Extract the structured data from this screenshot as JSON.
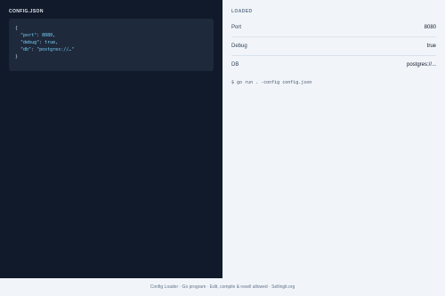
{
  "left_panel": {
    "title": "CONFIG.JSON",
    "code": {
      "open_brace": "{",
      "lines": [
        {
          "key": "\"port\"",
          "sep": ": ",
          "value": "8080",
          "trail": ","
        },
        {
          "key": "\"debug\"",
          "sep": ": ",
          "value": "true",
          "trail": ","
        },
        {
          "key": "\"db\"",
          "sep": ": ",
          "value": "\"postgres://…\"",
          "trail": ""
        }
      ],
      "close_brace": "}"
    }
  },
  "right_panel": {
    "title": "LOADED",
    "rows": [
      {
        "label": "Port",
        "value": "8080"
      },
      {
        "label": "Debug",
        "value": "true"
      },
      {
        "label": "DB",
        "value": "postgres://..."
      }
    ],
    "command": "$ go run . -config config.json"
  },
  "footer": {
    "text": "Config Loader · Go program · Edit, compile & resell allowed · Sellingit.org"
  },
  "colors": {
    "left_bg": "#111a2a",
    "card_bg": "#1e293b",
    "right_bg": "#f1f5f9",
    "code_key": "#7dd3fc"
  }
}
